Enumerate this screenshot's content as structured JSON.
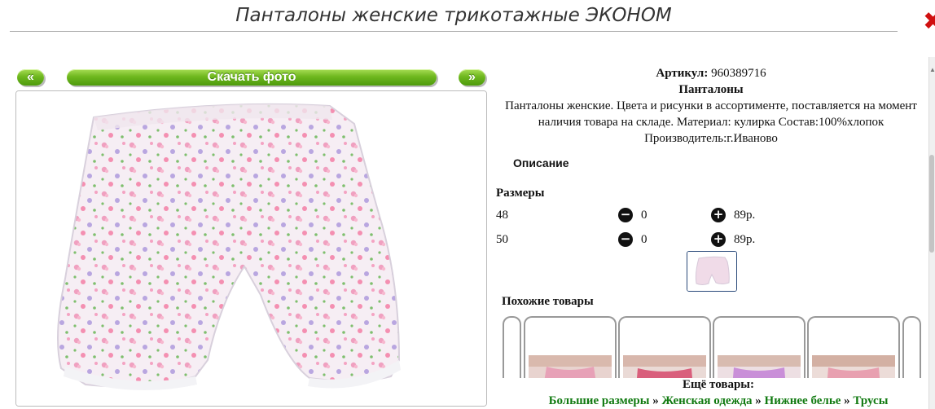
{
  "page": {
    "title": "Панталоны женские трикотажные ЭКОНОМ"
  },
  "gallery": {
    "prev_label": "«",
    "download_label": "Скачать фото",
    "next_label": "»"
  },
  "product": {
    "article_label": "Артикул:",
    "article_value": "960389716",
    "name": "Панталоны",
    "description": "Панталоны женские. Цвета и рисунки в ассортименте, поставляется на момент наличия товара на складе. Материал: кулирка Состав:100%хлопок Производитель:г.Иваново",
    "description_tab": "Описание"
  },
  "sizes": {
    "heading": "Размеры",
    "rows": [
      {
        "size": "48",
        "qty": "0",
        "price": "89р."
      },
      {
        "size": "50",
        "qty": "0",
        "price": "89р."
      }
    ]
  },
  "similar": {
    "heading": "Похожие товары"
  },
  "more": {
    "heading": "Ещё товары:",
    "links": [
      "Большие размеры",
      "Женская одежда",
      "Нижнее белье",
      "Трусы"
    ],
    "separator": "»"
  },
  "colors": {
    "accent_green": "#6fb81f",
    "link_green": "#117a11",
    "close_red": "#d01010"
  },
  "icons": {
    "close": "close-icon",
    "minus": "minus-circle-icon",
    "plus": "plus-circle-icon"
  }
}
